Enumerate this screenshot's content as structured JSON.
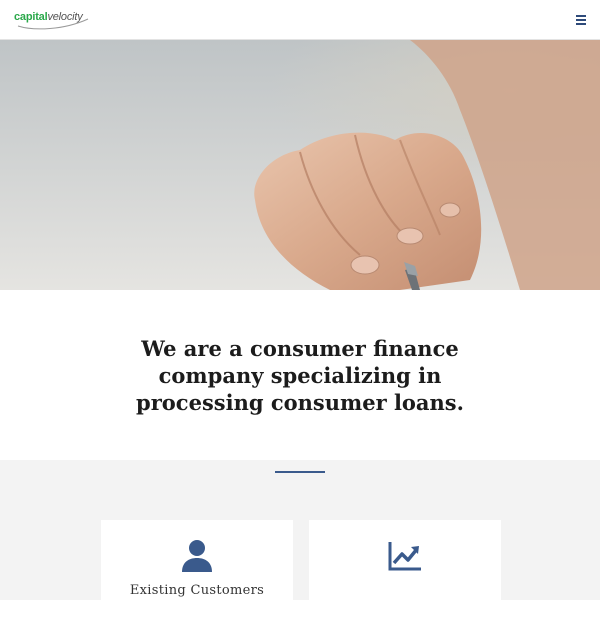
{
  "brand": {
    "logo_capital": "capital",
    "logo_velocity": "velocity",
    "logo_colors": {
      "capital": "#2aa84a",
      "velocity": "#555555"
    }
  },
  "header": {
    "menu_icon": "hamburger-menu-icon"
  },
  "hero": {
    "image_subject": "hand-holding-pen"
  },
  "tagline": {
    "text": "We are a consumer finance company specializing in processing consumer loans."
  },
  "features": {
    "accent_color": "#3a5a8c",
    "cards": [
      {
        "icon": "user-icon",
        "label": "Existing Customers"
      },
      {
        "icon": "chart-line-icon",
        "label": ""
      }
    ]
  }
}
